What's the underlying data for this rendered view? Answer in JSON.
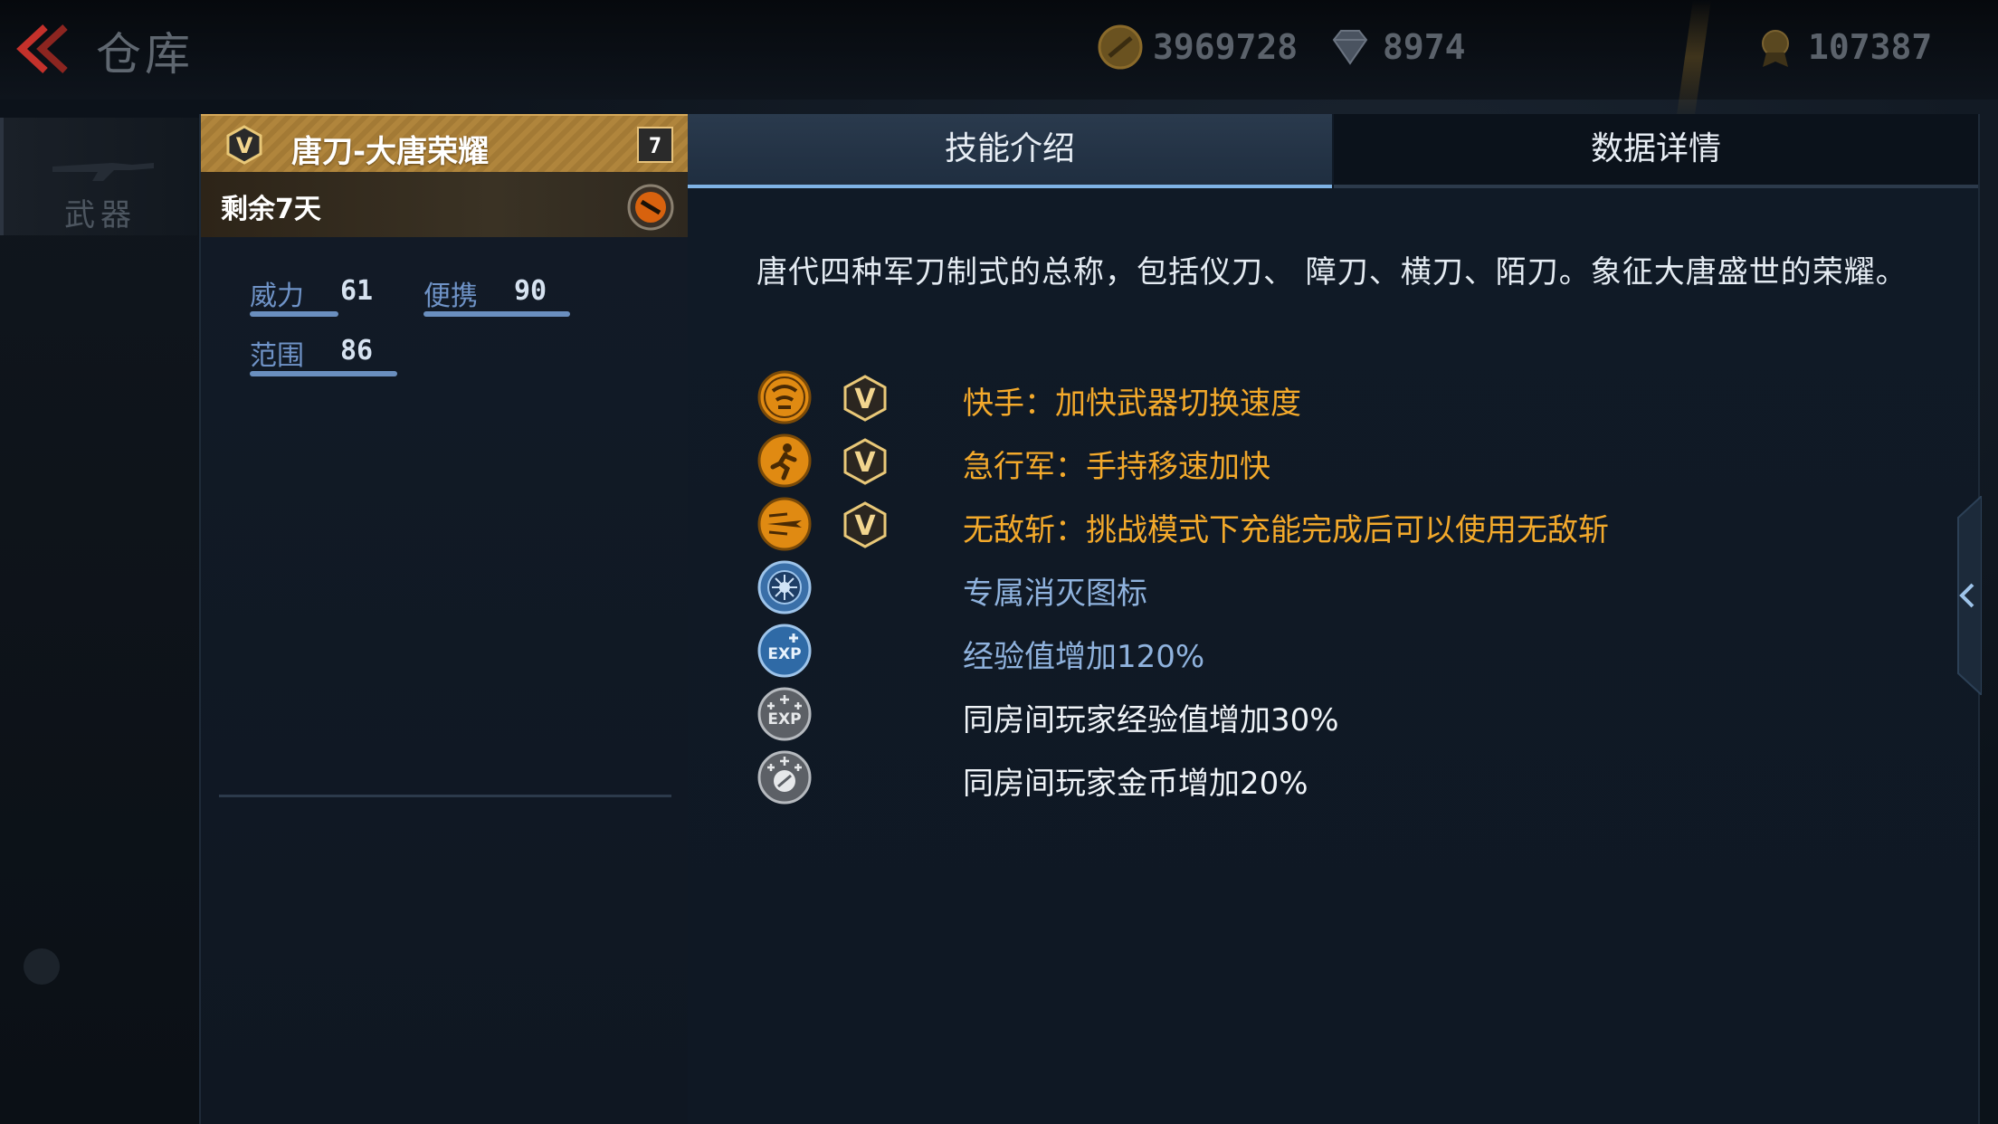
{
  "header": {
    "title": "仓库",
    "coins": "3969728",
    "diamonds": "8974",
    "medals": "107387"
  },
  "sidebar": {
    "weapon_tab": "武器"
  },
  "item": {
    "name": "唐刀-大唐荣耀",
    "level": "7",
    "remaining": "剩余7天",
    "stats": [
      {
        "label": "威力",
        "value": "61",
        "fill": 0.61
      },
      {
        "label": "便携",
        "value": "90",
        "fill": 0.9
      },
      {
        "label": "范围",
        "value": "86",
        "fill": 0.86
      }
    ]
  },
  "tabs": {
    "skills": "技能介绍",
    "data": "数据详情",
    "active": "skills"
  },
  "description": "唐代四种军刀制式的总称，包括仪刀、 障刀、横刀、陌刀。象征大唐盛世的荣耀。",
  "skills": [
    {
      "icon": "quick-hand-icon",
      "vip": true,
      "text": "快手：加快武器切换速度",
      "color": "#f3a92b"
    },
    {
      "icon": "running-man-icon",
      "vip": true,
      "text": "急行军：手持移速加快",
      "color": "#f3a92b"
    },
    {
      "icon": "blade-slash-icon",
      "vip": true,
      "text": "无敌斩：挑战模式下充能完成后可以使用无敌斩",
      "color": "#f3a92b"
    },
    {
      "icon": "elimination-badge-icon",
      "vip": false,
      "text": "专属消灭图标",
      "color": "#8fb2dd"
    },
    {
      "icon": "exp-boost-icon",
      "vip": false,
      "text": "经验值增加120%",
      "color": "#8fb2dd"
    },
    {
      "icon": "team-exp-icon",
      "vip": false,
      "text": "同房间玩家经验值增加30%",
      "color": "#f0f4f8"
    },
    {
      "icon": "team-coin-icon",
      "vip": false,
      "text": "同房间玩家金币增加20%",
      "color": "#f0f4f8"
    }
  ],
  "colors": {
    "accent_gold": "#f3a92b",
    "accent_blue": "#8fb2dd",
    "tab_active_underline": "#7fb3e6"
  }
}
